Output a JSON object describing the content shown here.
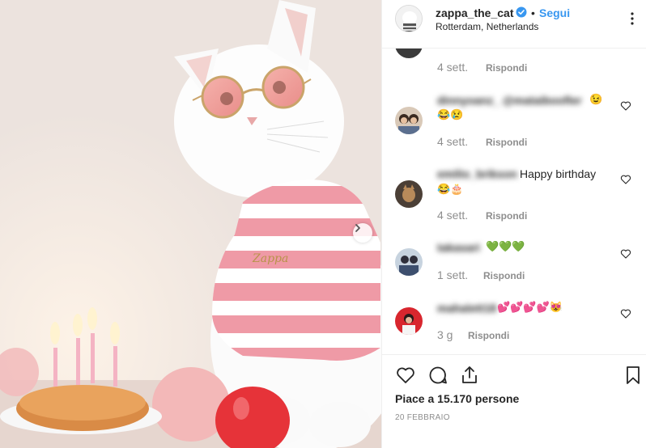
{
  "post": {
    "username": "zappa_the_cat",
    "verified": true,
    "separator": "•",
    "follow_label": "Segui",
    "location": "Rotterdam, Netherlands",
    "photo_text": "Zappa"
  },
  "comments": [
    {
      "user": "",
      "text": "",
      "time": "4 sett.",
      "reply": "Rispondi"
    },
    {
      "user": "dinnyoanz_ @mataiboofler",
      "text": "😂😢",
      "time": "4 sett.",
      "reply": "Rispondi",
      "emoji_head": "😉"
    },
    {
      "user": "emilio_brikson",
      "text": "Happy birthday",
      "emoji_line": "😂🎂",
      "time": "4 sett.",
      "reply": "Rispondi"
    },
    {
      "user": "takasari",
      "text": "💚💚💚",
      "time": "1 sett.",
      "reply": "Rispondi"
    },
    {
      "user": "mahalett18",
      "text": "💕💕💕💕😻",
      "time": "3 g",
      "reply": "Rispondi"
    }
  ],
  "footer": {
    "likes": "Piace a 15.170 persone",
    "date": "20 FEBBRAIO"
  },
  "icons": [
    "heart-icon",
    "comment-icon",
    "share-icon",
    "bookmark-icon",
    "more-icon",
    "verified-badge-icon",
    "chevron-right-icon"
  ],
  "colors": {
    "accent": "#3897f0",
    "text": "#262626",
    "muted": "#8e8e8e",
    "border": "#efefef"
  }
}
